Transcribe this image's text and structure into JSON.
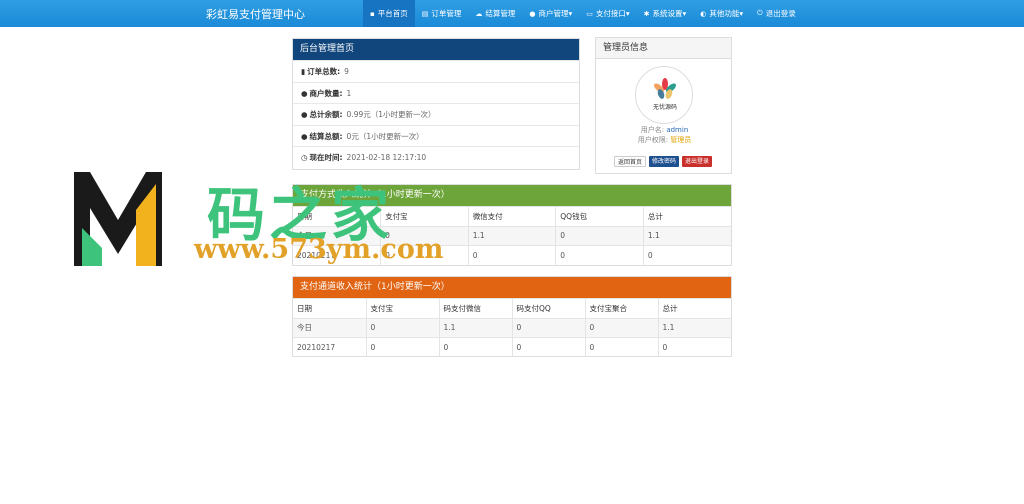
{
  "brand": "彩虹易支付管理中心",
  "nav": [
    {
      "icon": "home-icon",
      "glyph": "▪",
      "label": "平台首页",
      "active": true
    },
    {
      "icon": "list-icon",
      "glyph": "▤",
      "label": "订单管理"
    },
    {
      "icon": "cloud-icon",
      "glyph": "☁",
      "label": "结算管理"
    },
    {
      "icon": "user-icon",
      "glyph": "●",
      "label": "商户管理▾"
    },
    {
      "icon": "card-icon",
      "glyph": "▭",
      "label": "支付接口▾"
    },
    {
      "icon": "gear-icon",
      "glyph": "✱",
      "label": "系统设置▾"
    },
    {
      "icon": "globe-icon",
      "glyph": "◐",
      "label": "其他功能▾"
    },
    {
      "icon": "power-icon",
      "glyph": "⏻",
      "label": "退出登录"
    }
  ],
  "overview": {
    "title": "后台管理首页",
    "rows": [
      {
        "icon": "bar-chart-icon",
        "glyph": "▮",
        "label": "订单总数:",
        "value": "9"
      },
      {
        "icon": "drop-icon",
        "glyph": "●",
        "label": "商户数量:",
        "value": "1"
      },
      {
        "icon": "drop-icon",
        "glyph": "●",
        "label": "总计余额:",
        "value": "0.99元（1小时更新一次）"
      },
      {
        "icon": "drop-icon",
        "glyph": "●",
        "label": "结算总额:",
        "value": "0元（1小时更新一次）"
      },
      {
        "icon": "clock-icon",
        "glyph": "◷",
        "label": "现在时间:",
        "value": "2021-02-18 12:17:10"
      }
    ]
  },
  "admin": {
    "title": "管理员信息",
    "avatar_text": "无忧源码",
    "username_label": "用户名:",
    "username": "admin",
    "role_label": "用户权限:",
    "role": "管理员",
    "buttons": [
      "返回首页",
      "修改密码",
      "退出登录"
    ]
  },
  "stats_type": {
    "title": "支付方式收入统计（1小时更新一次）",
    "headers": [
      "日期",
      "支付宝",
      "微信支付",
      "QQ钱包",
      "总计"
    ],
    "rows": [
      [
        "今日",
        "0",
        "1.1",
        "0",
        "1.1"
      ],
      [
        "20210217",
        "0",
        "0",
        "0",
        "0"
      ]
    ]
  },
  "stats_channel": {
    "title": "支付通道收入统计（1小时更新一次）",
    "headers": [
      "日期",
      "支付宝",
      "码支付微信",
      "码支付QQ",
      "支付宝聚合",
      "总计"
    ],
    "rows": [
      [
        "今日",
        "0",
        "1.1",
        "0",
        "0",
        "1.1"
      ],
      [
        "20210217",
        "0",
        "0",
        "0",
        "0",
        "0"
      ]
    ]
  },
  "watermark": {
    "cn": "码之家",
    "url": "www.573ym.com"
  },
  "colors": {
    "nav": "#1b8ad8",
    "overview_head": "#11467c",
    "type_head": "#6ea53a",
    "channel_head": "#e16413"
  }
}
